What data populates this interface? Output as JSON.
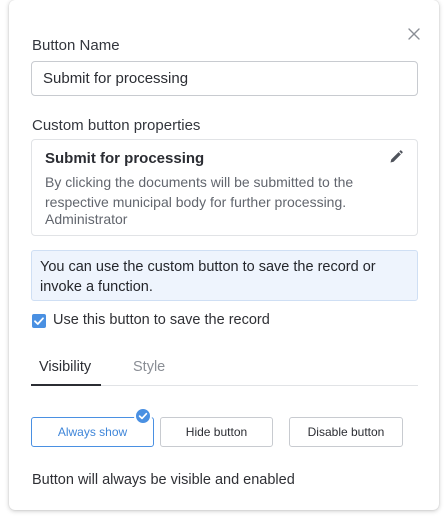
{
  "dialog": {
    "close_icon": "close-icon"
  },
  "button_name": {
    "label": "Button Name",
    "value": "Submit for processing"
  },
  "properties": {
    "label": "Custom button properties",
    "title": "Submit for processing",
    "description": "By clicking the documents will be submitted to the respective municipal body for further processing.",
    "role": "Administrator",
    "edit_icon": "pencil-icon"
  },
  "info": {
    "text": "You can use the custom button to save the record or invoke a function."
  },
  "save_record": {
    "checked": true,
    "label": "Use this button to save the record"
  },
  "tabs": [
    {
      "label": "Visibility",
      "active": true
    },
    {
      "label": "Style",
      "active": false
    }
  ],
  "visibility_options": [
    {
      "label": "Always show",
      "selected": true
    },
    {
      "label": "Hide button",
      "selected": false
    },
    {
      "label": "Disable button",
      "selected": false
    }
  ],
  "status": {
    "text": "Button will always be visible and enabled"
  },
  "colors": {
    "accent": "#4a90e2",
    "info_bg": "#eef4fd",
    "text": "#2f3035",
    "muted": "#62666e"
  }
}
